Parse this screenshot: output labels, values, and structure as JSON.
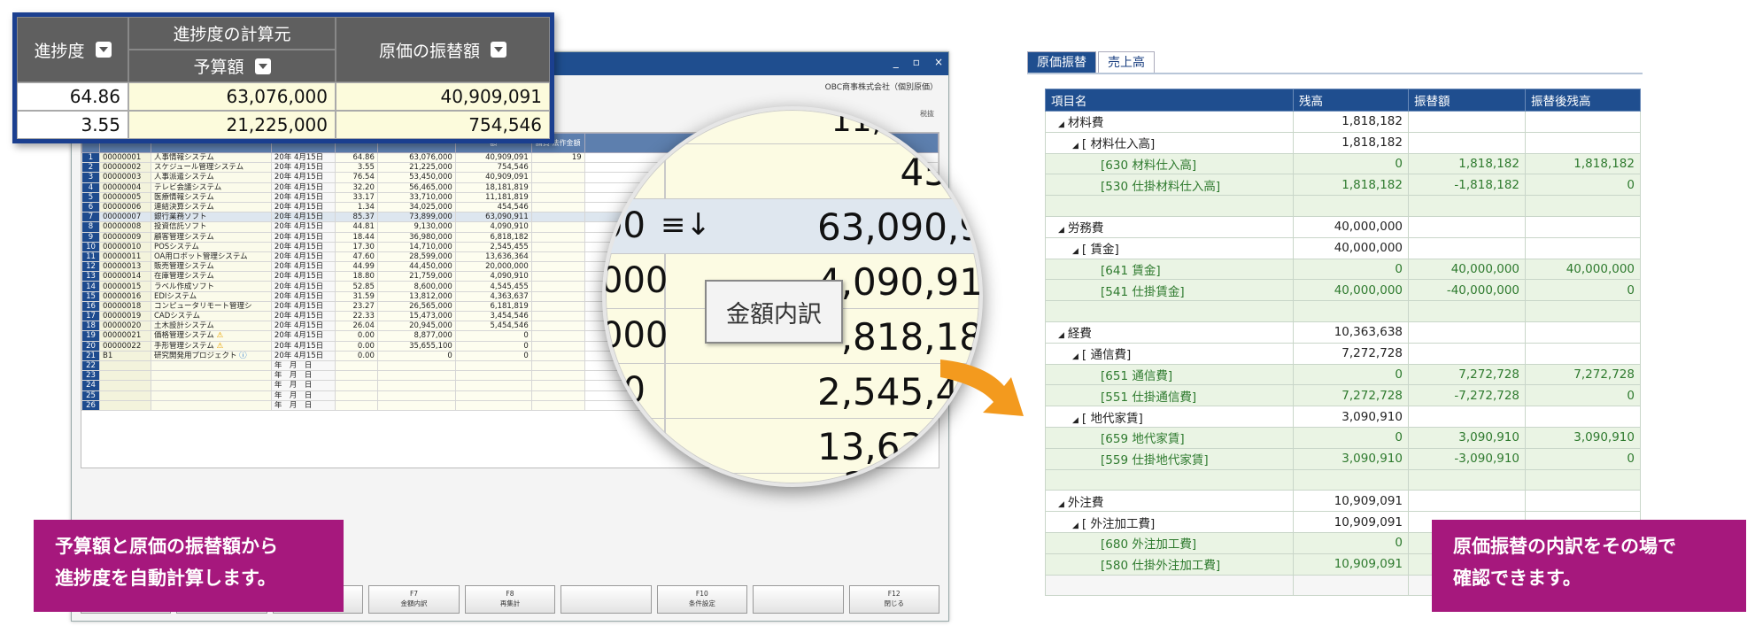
{
  "app": {
    "company": "OBC商事株式会社（個別原価）",
    "unit": "税抜",
    "window_controls": [
      "_",
      "▫",
      "×"
    ]
  },
  "grid": {
    "rows": [
      {
        "n": "1",
        "code": "00000001",
        "name": "人事情報システム",
        "date": "20年 4月15日",
        "pct": "64.86",
        "budget": "63,076,000",
        "amt": "40,909,091",
        "x": "19"
      },
      {
        "n": "2",
        "code": "00000002",
        "name": "スケジュール管理システム",
        "date": "20年 4月15日",
        "pct": "3.55",
        "budget": "21,225,000",
        "amt": "754,546",
        "x": ""
      },
      {
        "n": "3",
        "code": "00000003",
        "name": "人事派遣システム",
        "date": "20年 4月15日",
        "pct": "76.54",
        "budget": "53,450,000",
        "amt": "40,909,091",
        "x": ""
      },
      {
        "n": "4",
        "code": "00000004",
        "name": "テレビ会議システム",
        "date": "20年 4月15日",
        "pct": "32.20",
        "budget": "56,465,000",
        "amt": "18,181,819",
        "x": ""
      },
      {
        "n": "5",
        "code": "00000005",
        "name": "医療情報システム",
        "date": "20年 4月15日",
        "pct": "33.17",
        "budget": "33,710,000",
        "amt": "11,181,819",
        "x": ""
      },
      {
        "n": "6",
        "code": "00000006",
        "name": "連結決算システム",
        "date": "20年 4月15日",
        "pct": "1.34",
        "budget": "34,025,000",
        "amt": "454,546",
        "x": ""
      },
      {
        "n": "7",
        "code": "00000007",
        "name": "銀行業務ソフト",
        "date": "20年 4月15日",
        "pct": "85.37",
        "budget": "73,899,000",
        "amt": "63,090,911",
        "x": ""
      },
      {
        "n": "8",
        "code": "00000008",
        "name": "投資信託ソフト",
        "date": "20年 4月15日",
        "pct": "44.81",
        "budget": "9,130,000",
        "amt": "4,090,910",
        "x": ""
      },
      {
        "n": "9",
        "code": "00000009",
        "name": "顧客管理システム",
        "date": "20年 4月15日",
        "pct": "18.44",
        "budget": "36,980,000",
        "amt": "6,818,182",
        "x": ""
      },
      {
        "n": "10",
        "code": "00000010",
        "name": "POSシステム",
        "date": "20年 4月15日",
        "pct": "17.30",
        "budget": "14,710,000",
        "amt": "2,545,455",
        "x": ""
      },
      {
        "n": "11",
        "code": "00000011",
        "name": "OA用ロボット管理システム",
        "date": "20年 4月15日",
        "pct": "47.60",
        "budget": "28,599,000",
        "amt": "13,636,364",
        "x": ""
      },
      {
        "n": "12",
        "code": "00000013",
        "name": "販売管理システム",
        "date": "20年 4月15日",
        "pct": "44.99",
        "budget": "44,450,000",
        "amt": "20,000,000",
        "x": ""
      },
      {
        "n": "13",
        "code": "00000014",
        "name": "在庫管理システム",
        "date": "20年 4月15日",
        "pct": "18.80",
        "budget": "21,759,000",
        "amt": "4,090,910",
        "x": ""
      },
      {
        "n": "14",
        "code": "00000015",
        "name": "ラベル作成ソフト",
        "date": "20年 4月15日",
        "pct": "52.85",
        "budget": "8,600,000",
        "amt": "4,545,455",
        "x": ""
      },
      {
        "n": "15",
        "code": "00000016",
        "name": "EDIシステム",
        "date": "20年 4月15日",
        "pct": "31.59",
        "budget": "13,812,000",
        "amt": "4,363,637",
        "x": ""
      },
      {
        "n": "16",
        "code": "00000018",
        "name": "コンピュータリモート管理シ",
        "date": "20年 4月15日",
        "pct": "23.27",
        "budget": "26,565,000",
        "amt": "6,181,819",
        "x": ""
      },
      {
        "n": "17",
        "code": "00000019",
        "name": "CADシステム",
        "date": "20年 4月15日",
        "pct": "22.33",
        "budget": "15,473,000",
        "amt": "3,454,546",
        "x": ""
      },
      {
        "n": "18",
        "code": "00000020",
        "name": "土木設計システム",
        "date": "20年 4月15日",
        "pct": "26.04",
        "budget": "20,945,000",
        "amt": "5,454,546",
        "x": ""
      },
      {
        "n": "19",
        "code": "00000021",
        "name": "価格管理システム",
        "date": "20年 4月15日",
        "pct": "0.00",
        "budget": "8,877,000",
        "amt": "0",
        "x": ""
      },
      {
        "n": "20",
        "code": "00000022",
        "name": "手形管理システム",
        "date": "20年 4月15日",
        "pct": "0.00",
        "budget": "35,655,100",
        "amt": "0",
        "x": ""
      },
      {
        "n": "21",
        "code": "B1",
        "name": "研究開発用プロジェクト",
        "date": "20年 4月15日",
        "pct": "0.00",
        "budget": "0",
        "amt": "0",
        "x": ""
      },
      {
        "n": "22",
        "code": "",
        "name": "",
        "date": "年　月　日",
        "pct": "",
        "budget": "",
        "amt": "",
        "x": ""
      },
      {
        "n": "23",
        "code": "",
        "name": "",
        "date": "年　月　日",
        "pct": "",
        "budget": "",
        "amt": "",
        "x": ""
      },
      {
        "n": "24",
        "code": "",
        "name": "",
        "date": "年　月　日",
        "pct": "",
        "budget": "",
        "amt": "",
        "x": ""
      },
      {
        "n": "25",
        "code": "",
        "name": "",
        "date": "年　月　日",
        "pct": "",
        "budget": "",
        "amt": "",
        "x": ""
      },
      {
        "n": "26",
        "code": "",
        "name": "",
        "date": "年　月　日",
        "pct": "",
        "budget": "",
        "amt": "",
        "x": ""
      }
    ],
    "header_small": "請負\n法作金額",
    "header_col": "額"
  },
  "fkeys": [
    {
      "k": "",
      "t": ""
    },
    {
      "k": "",
      "t": ""
    },
    {
      "k": "F6",
      "t": "ジャンプ"
    },
    {
      "k": "F7",
      "t": "金額内訳"
    },
    {
      "k": "F8",
      "t": "再集計"
    },
    {
      "k": "",
      "t": ""
    },
    {
      "k": "F10",
      "t": "条件設定"
    },
    {
      "k": "",
      "t": ""
    },
    {
      "k": "F12",
      "t": "閉じる"
    }
  ],
  "zoom": {
    "h_progress": "進捗度",
    "h_calc_source": "進捗度の計算元",
    "h_budget": "予算額",
    "h_transfer": "原価の振替額",
    "rows": [
      {
        "progress": "64.86",
        "budget": "63,076,000",
        "transfer": "40,909,091"
      },
      {
        "progress": "3.55",
        "budget": "21,225,000",
        "transfer": "754,546"
      }
    ]
  },
  "magnifier": {
    "top_value": "11,",
    "values": [
      "454,",
      "63,090,9",
      "4,090,91",
      ",818,18",
      "2,545,45",
      "13,636,3",
      "20,0"
    ],
    "left_vals": [
      "00",
      "000",
      "000",
      "00",
      ")"
    ],
    "button_label": "金額内訳",
    "sort_icon": "≡↓"
  },
  "right": {
    "tabs": [
      "原価振替",
      "売上高"
    ],
    "headers": [
      "項目名",
      "残高",
      "振替額",
      "振替後残高"
    ],
    "rows": [
      {
        "cls": "g1",
        "ind": "ind1",
        "tri": "◢",
        "name": "材料費",
        "bal": "1,818,182",
        "tr": "",
        "after": ""
      },
      {
        "cls": "g2",
        "ind": "ind2",
        "tri": "◢",
        "name": "[ 材料仕入高]",
        "bal": "1,818,182",
        "tr": "",
        "after": ""
      },
      {
        "cls": "leaf",
        "ind": "ind3",
        "tri": "",
        "name": "[630 材料仕入高]",
        "bal": "0",
        "tr": "1,818,182",
        "after": "1,818,182"
      },
      {
        "cls": "leaf",
        "ind": "ind3",
        "tri": "",
        "name": "[530 仕掛材料仕入高]",
        "bal": "1,818,182",
        "tr": "-1,818,182",
        "after": "0"
      },
      {
        "cls": "blank",
        "ind": "",
        "tri": "",
        "name": "",
        "bal": "",
        "tr": "",
        "after": ""
      },
      {
        "cls": "g1",
        "ind": "ind1",
        "tri": "◢",
        "name": "労務費",
        "bal": "40,000,000",
        "tr": "",
        "after": ""
      },
      {
        "cls": "g2",
        "ind": "ind2",
        "tri": "◢",
        "name": "[ 賃金]",
        "bal": "40,000,000",
        "tr": "",
        "after": ""
      },
      {
        "cls": "leaf",
        "ind": "ind3",
        "tri": "",
        "name": "[641 賃金]",
        "bal": "0",
        "tr": "40,000,000",
        "after": "40,000,000"
      },
      {
        "cls": "leaf",
        "ind": "ind3",
        "tri": "",
        "name": "[541 仕掛賃金]",
        "bal": "40,000,000",
        "tr": "-40,000,000",
        "after": "0"
      },
      {
        "cls": "blank",
        "ind": "",
        "tri": "",
        "name": "",
        "bal": "",
        "tr": "",
        "after": ""
      },
      {
        "cls": "g1",
        "ind": "ind1",
        "tri": "◢",
        "name": "経費",
        "bal": "10,363,638",
        "tr": "",
        "after": ""
      },
      {
        "cls": "g2",
        "ind": "ind2",
        "tri": "◢",
        "name": "[ 通信費]",
        "bal": "7,272,728",
        "tr": "",
        "after": ""
      },
      {
        "cls": "leaf",
        "ind": "ind3",
        "tri": "",
        "name": "[651 通信費]",
        "bal": "0",
        "tr": "7,272,728",
        "after": "7,272,728"
      },
      {
        "cls": "leaf",
        "ind": "ind3",
        "tri": "",
        "name": "[551 仕掛通信費]",
        "bal": "7,272,728",
        "tr": "-7,272,728",
        "after": "0"
      },
      {
        "cls": "g2",
        "ind": "ind2",
        "tri": "◢",
        "name": "[ 地代家賃]",
        "bal": "3,090,910",
        "tr": "",
        "after": ""
      },
      {
        "cls": "leaf",
        "ind": "ind3",
        "tri": "",
        "name": "[659 地代家賃]",
        "bal": "0",
        "tr": "3,090,910",
        "after": "3,090,910"
      },
      {
        "cls": "leaf",
        "ind": "ind3",
        "tri": "",
        "name": "[559 仕掛地代家賃]",
        "bal": "3,090,910",
        "tr": "-3,090,910",
        "after": "0"
      },
      {
        "cls": "blank",
        "ind": "",
        "tri": "",
        "name": "",
        "bal": "",
        "tr": "",
        "after": ""
      },
      {
        "cls": "g1",
        "ind": "ind1",
        "tri": "◢",
        "name": "外注費",
        "bal": "10,909,091",
        "tr": "",
        "after": ""
      },
      {
        "cls": "g2",
        "ind": "ind2",
        "tri": "◢",
        "name": "[ 外注加工費]",
        "bal": "10,909,091",
        "tr": "",
        "after": ""
      },
      {
        "cls": "leaf",
        "ind": "ind3",
        "tri": "",
        "name": "[680 外注加工費]",
        "bal": "0",
        "tr": "",
        "after": ""
      },
      {
        "cls": "leaf",
        "ind": "ind3",
        "tri": "",
        "name": "[580 仕掛外注加工費]",
        "bal": "10,909,091",
        "tr": "",
        "after": ""
      },
      {
        "cls": "blank-w",
        "ind": "",
        "tri": "",
        "name": "",
        "bal": "",
        "tr": "",
        "after": ""
      }
    ]
  },
  "banners": {
    "left_line1": "予算額と原価の振替額から",
    "left_line2": "進捗度を自動計算します。",
    "right_line1": "原価振替の内訳をその場で",
    "right_line2": "確認できます。"
  },
  "colors": {
    "banner": "#a6187d",
    "arrow": "#f39a1e",
    "header_blue": "#1f4e8f"
  }
}
